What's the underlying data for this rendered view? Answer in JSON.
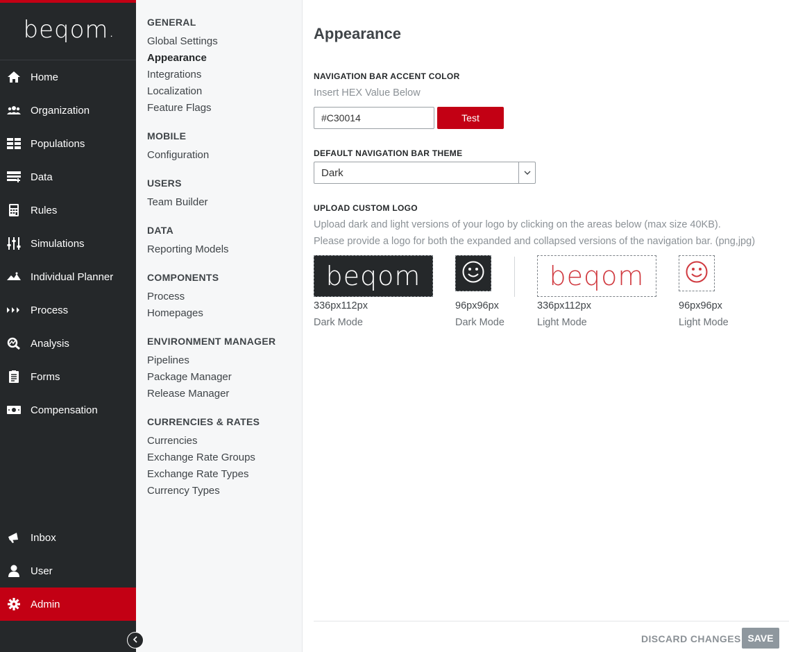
{
  "brand": {
    "logo_text": "beqom",
    "accent_color": "#C30014",
    "nav_bg": "#25282a"
  },
  "nav": {
    "items": [
      {
        "label": "Home",
        "icon": "home-icon"
      },
      {
        "label": "Organization",
        "icon": "people-icon"
      },
      {
        "label": "Populations",
        "icon": "grid-icon"
      },
      {
        "label": "Data",
        "icon": "table-icon"
      },
      {
        "label": "Rules",
        "icon": "calculator-icon"
      },
      {
        "label": "Simulations",
        "icon": "sliders-icon"
      },
      {
        "label": "Individual Planner",
        "icon": "planner-icon"
      },
      {
        "label": "Process",
        "icon": "arrows-icon"
      },
      {
        "label": "Analysis",
        "icon": "analysis-icon"
      },
      {
        "label": "Forms",
        "icon": "clipboard-icon"
      },
      {
        "label": "Compensation",
        "icon": "money-icon"
      }
    ],
    "bottom_items": [
      {
        "label": "Inbox",
        "icon": "megaphone-icon"
      },
      {
        "label": "User",
        "icon": "user-icon"
      },
      {
        "label": "Admin",
        "icon": "gear-icon",
        "active": true
      }
    ]
  },
  "submenu": {
    "sections": [
      {
        "heading": "GENERAL",
        "items": [
          "Global Settings",
          "Appearance",
          "Integrations",
          "Localization",
          "Feature Flags"
        ]
      },
      {
        "heading": "MOBILE",
        "items": [
          "Configuration"
        ]
      },
      {
        "heading": "USERS",
        "items": [
          "Team Builder"
        ]
      },
      {
        "heading": "DATA",
        "items": [
          "Reporting Models"
        ]
      },
      {
        "heading": "COMPONENTS",
        "items": [
          "Process",
          "Homepages"
        ]
      },
      {
        "heading": "ENVIRONMENT MANAGER",
        "items": [
          "Pipelines",
          "Package Manager",
          "Release Manager"
        ]
      },
      {
        "heading": "CURRENCIES & RATES",
        "items": [
          "Currencies",
          "Exchange Rate Groups",
          "Exchange Rate Types",
          "Currency Types"
        ]
      }
    ],
    "active_item": "Appearance"
  },
  "main": {
    "title": "Appearance",
    "accent": {
      "label": "NAVIGATION BAR ACCENT COLOR",
      "hint": "Insert HEX Value Below",
      "value": "#C30014",
      "test_label": "Test"
    },
    "theme": {
      "label": "DEFAULT NAVIGATION BAR THEME",
      "selected": "Dark"
    },
    "upload": {
      "label": "UPLOAD CUSTOM LOGO",
      "hint1": "Upload dark and light versions of your logo by clicking on the areas below (max size 40KB).",
      "hint2": "Please provide a logo for both the expanded and collapsed versions of the navigation bar. (png,jpg)",
      "logos": [
        {
          "size": "336px112px",
          "mode": "Dark Mode"
        },
        {
          "size": "96px96px",
          "mode": "Dark Mode"
        },
        {
          "size": "336px112px",
          "mode": "Light Mode"
        },
        {
          "size": "96px96px",
          "mode": "Light Mode"
        }
      ]
    },
    "footer": {
      "discard_label": "DISCARD CHANGES",
      "save_label": "SAVE"
    }
  }
}
